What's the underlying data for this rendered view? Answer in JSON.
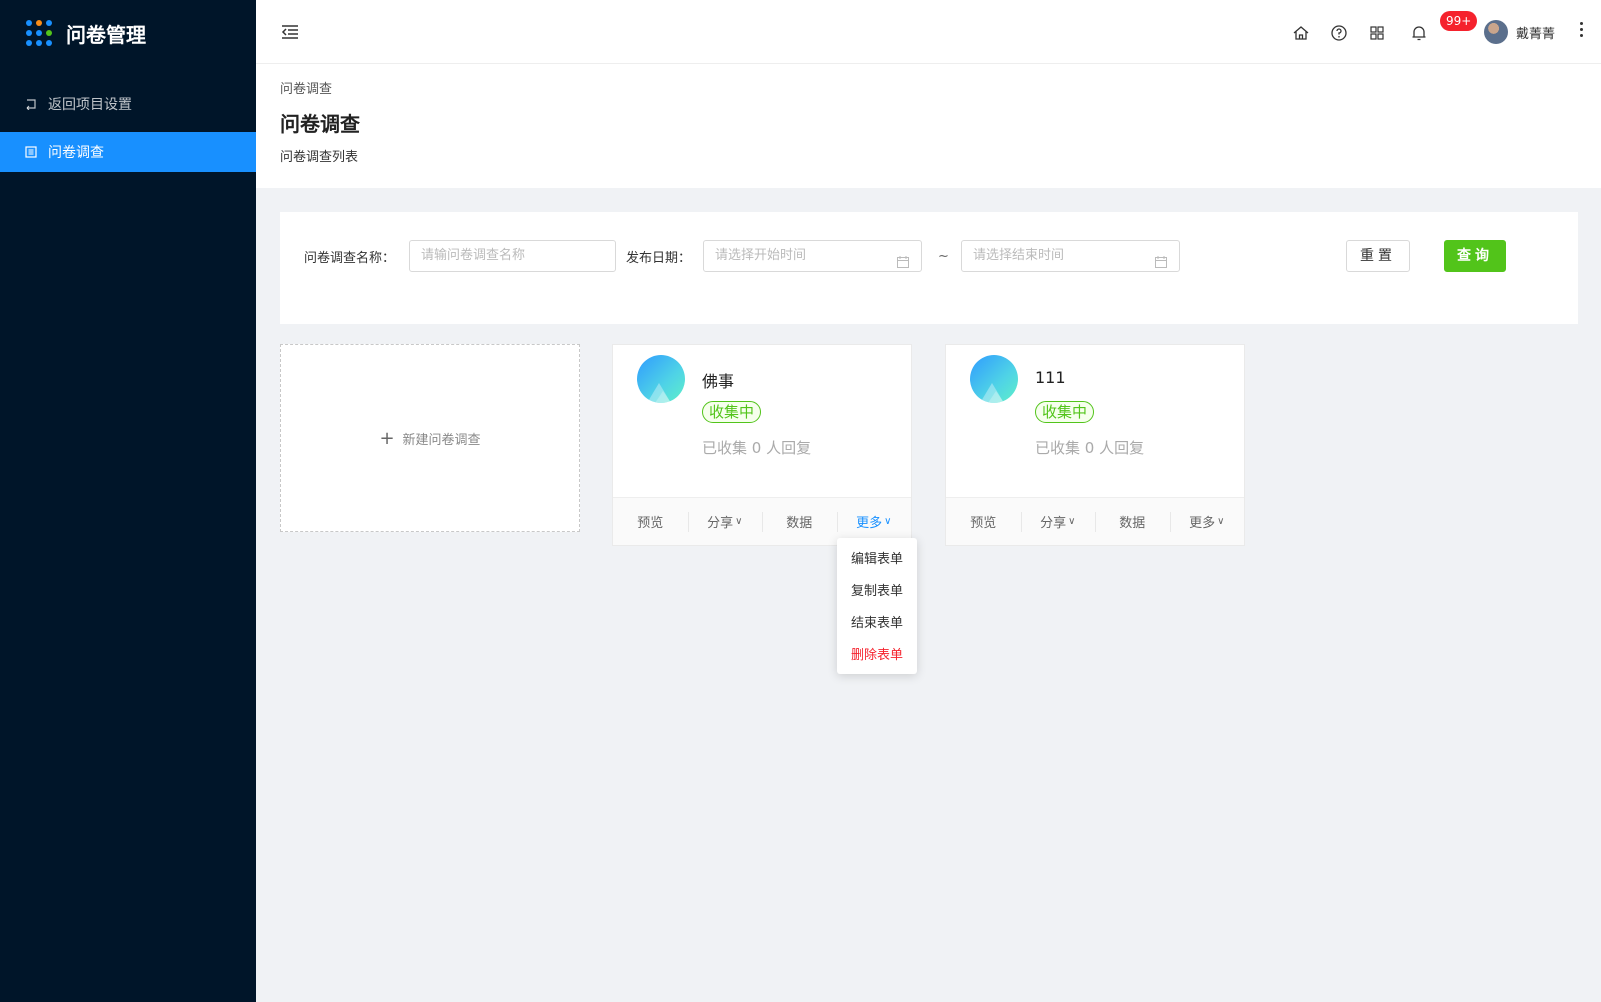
{
  "app": {
    "title": "问卷管理"
  },
  "sidebar": {
    "items": [
      {
        "label": "返回项目设置",
        "icon": "return-icon",
        "active": false
      },
      {
        "label": "问卷调查",
        "icon": "list-icon",
        "active": true
      }
    ]
  },
  "header": {
    "notification_count": "99+",
    "username": "戴菁菁",
    "icons": [
      "home-icon",
      "help-icon",
      "apps-icon",
      "bell-icon"
    ]
  },
  "page": {
    "breadcrumb": "问卷调查",
    "title": "问卷调查",
    "subtitle": "问卷调查列表"
  },
  "search": {
    "name_label": "问卷调查名称：",
    "name_placeholder": "请输问卷调查名称",
    "date_label": "发布日期：",
    "start_placeholder": "请选择开始时间",
    "separator": "~",
    "end_placeholder": "请选择结束时间",
    "reset_label": "重置",
    "query_label": "查询"
  },
  "new_card": {
    "label": "新建问卷调查"
  },
  "cards": [
    {
      "name": "佛事",
      "status": "收集中",
      "count_text": "已收集 0 人回复",
      "actions": {
        "preview": "预览",
        "share": "分享",
        "data": "数据",
        "more": "更多"
      }
    },
    {
      "name": "111",
      "status": "收集中",
      "count_text": "已收集 0 人回复",
      "actions": {
        "preview": "预览",
        "share": "分享",
        "data": "数据",
        "more": "更多"
      }
    }
  ],
  "more_menu": {
    "items": [
      "编辑表单",
      "复制表单",
      "结束表单",
      "删除表单"
    ]
  },
  "colors": {
    "primary": "#1890ff",
    "success": "#52c41a",
    "danger": "#f5222d",
    "sidebar": "#001529"
  }
}
